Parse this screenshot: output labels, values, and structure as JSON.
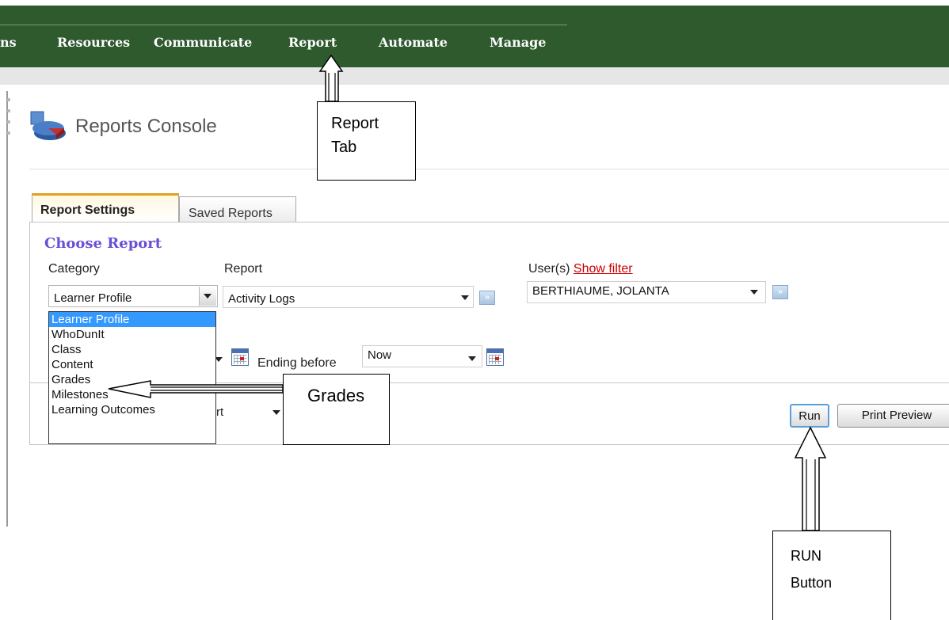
{
  "nav": {
    "items": [
      "ns",
      "Resources",
      "Communicate",
      "Report",
      "Automate",
      "Manage"
    ]
  },
  "console": {
    "title": "Reports Console"
  },
  "tabs": [
    "Report Settings",
    "Saved Reports"
  ],
  "choose_report": {
    "heading": "Choose Report",
    "category_label": "Category",
    "report_label": "Report",
    "users_label": "User(s)",
    "show_filter": "Show filter",
    "category_value": "Learner Profile",
    "report_value": "Activity Logs",
    "user_value": "BERTHIAUME, JOLANTA",
    "category_options": [
      "Learner Profile",
      "WhoDunIt",
      "Class",
      "Content",
      "Grades",
      "Milestones",
      "Learning Outcomes"
    ],
    "ending_before_label": "Ending before",
    "ending_before_value": "Now",
    "format_partial": "rt"
  },
  "buttons": {
    "run": "Run",
    "print_preview": "Print Preview"
  },
  "callouts": {
    "report_tab": [
      "Report",
      "Tab"
    ],
    "grades": "Grades",
    "run_button": [
      "RUN",
      "Button"
    ]
  }
}
